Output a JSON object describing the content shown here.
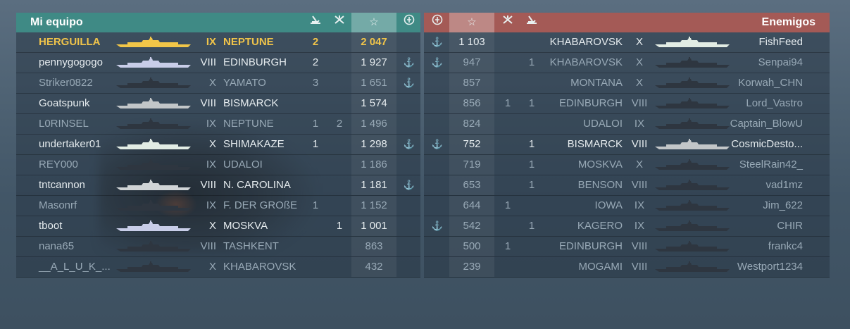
{
  "team": {
    "title": "Mi equipo",
    "header_icons": [
      "torpedo-hits-icon",
      "planes-destroyed-icon",
      "xp-star-icon",
      "achievement-icon"
    ],
    "players": [
      {
        "name": "HERGUILLA",
        "tier": "IX",
        "ship": "NEPTUNE",
        "torp": "2",
        "planes": "",
        "xp": "2 047",
        "ach": "",
        "me": true,
        "dead": false,
        "silhouette": "#f2c648"
      },
      {
        "name": "pennygogogo",
        "tier": "VIII",
        "ship": "EDINBURGH",
        "torp": "2",
        "planes": "",
        "xp": "1 927",
        "ach": "⚓",
        "dead": false,
        "silhouette": "#c8cde8"
      },
      {
        "name": "Striker0822",
        "tier": "X",
        "ship": "YAMATO",
        "torp": "3",
        "planes": "",
        "xp": "1 651",
        "ach": "⚓",
        "dead": true,
        "silhouette": "#2e3640"
      },
      {
        "name": "Goatspunk",
        "tier": "VIII",
        "ship": "BISMARCK",
        "torp": "",
        "planes": "",
        "xp": "1 574",
        "ach": "",
        "dead": false,
        "silhouette": "#c2c6c8"
      },
      {
        "name": "L0RINSEL",
        "tier": "IX",
        "ship": "NEPTUNE",
        "torp": "1",
        "planes": "2",
        "xp": "1 496",
        "ach": "",
        "dead": true,
        "silhouette": "#2e3640"
      },
      {
        "name": "undertaker01",
        "tier": "X",
        "ship": "SHIMAKAZE",
        "torp": "1",
        "planes": "",
        "xp": "1 298",
        "ach": "⚓",
        "dead": false,
        "silhouette": "#e2ece4"
      },
      {
        "name": "REY000",
        "tier": "IX",
        "ship": "UDALOI",
        "torp": "",
        "planes": "",
        "xp": "1 186",
        "ach": "",
        "dead": true,
        "silhouette": "#2e3640"
      },
      {
        "name": "tntcannon",
        "tier": "VIII",
        "ship": "N. CAROLINA",
        "torp": "",
        "planes": "",
        "xp": "1 181",
        "ach": "⚓",
        "dead": false,
        "silhouette": "#d0d4d6"
      },
      {
        "name": "Masonrf",
        "tier": "IX",
        "ship": "F. DER GROßE",
        "torp": "1",
        "planes": "",
        "xp": "1 152",
        "ach": "",
        "dead": true,
        "silhouette": "#2e3640"
      },
      {
        "name": "tboot",
        "tier": "X",
        "ship": "MOSKVA",
        "torp": "",
        "planes": "1",
        "xp": "1 001",
        "ach": "",
        "dead": false,
        "silhouette": "#c8cde8"
      },
      {
        "name": "nana65",
        "tier": "VIII",
        "ship": "TASHKENT",
        "torp": "",
        "planes": "",
        "xp": "863",
        "ach": "",
        "dead": true,
        "silhouette": "#2e3640"
      },
      {
        "name": "__A_L_U_K_...",
        "tier": "X",
        "ship": "KHABAROVSK",
        "torp": "",
        "planes": "",
        "xp": "432",
        "ach": "",
        "dead": true,
        "silhouette": "#2e3640"
      }
    ]
  },
  "enemy": {
    "title": "Enemigos",
    "header_icons": [
      "achievement-icon",
      "xp-star-icon",
      "planes-destroyed-icon",
      "torpedo-hits-icon"
    ],
    "players": [
      {
        "ach": "⚓",
        "xp": "1 103",
        "planes": "",
        "torp": "",
        "ship": "KHABAROVSK",
        "tier": "X",
        "name": "FishFeed",
        "dead": false,
        "silhouette": "#e2ece4"
      },
      {
        "ach": "⚓",
        "xp": "947",
        "planes": "",
        "torp": "1",
        "ship": "KHABAROVSK",
        "tier": "X",
        "name": "Senpai94",
        "dead": true,
        "silhouette": "#2e3640"
      },
      {
        "ach": "",
        "xp": "857",
        "planes": "",
        "torp": "",
        "ship": "MONTANA",
        "tier": "X",
        "name": "Korwah_CHN",
        "dead": true,
        "silhouette": "#2e3640"
      },
      {
        "ach": "",
        "xp": "856",
        "planes": "1",
        "torp": "1",
        "ship": "EDINBURGH",
        "tier": "VIII",
        "name": "Lord_Vastro",
        "dead": true,
        "silhouette": "#2e3640"
      },
      {
        "ach": "",
        "xp": "824",
        "planes": "",
        "torp": "",
        "ship": "UDALOI",
        "tier": "IX",
        "name": "Captain_BlowU",
        "dead": true,
        "silhouette": "#2e3640"
      },
      {
        "ach": "⚓",
        "xp": "752",
        "planes": "",
        "torp": "1",
        "ship": "BISMARCK",
        "tier": "VIII",
        "name": "CosmicDesto...",
        "dead": false,
        "silhouette": "#c2c6c8"
      },
      {
        "ach": "",
        "xp": "719",
        "planes": "",
        "torp": "1",
        "ship": "MOSKVA",
        "tier": "X",
        "name": "SteelRain42_",
        "dead": true,
        "silhouette": "#2e3640"
      },
      {
        "ach": "",
        "xp": "653",
        "planes": "",
        "torp": "1",
        "ship": "BENSON",
        "tier": "VIII",
        "name": "vad1mz",
        "dead": true,
        "silhouette": "#2e3640"
      },
      {
        "ach": "",
        "xp": "644",
        "planes": "1",
        "torp": "",
        "ship": "IOWA",
        "tier": "IX",
        "name": "Jim_622",
        "dead": true,
        "silhouette": "#2e3640"
      },
      {
        "ach": "⚓",
        "xp": "542",
        "planes": "",
        "torp": "1",
        "ship": "KAGERO",
        "tier": "IX",
        "name": "CHIR",
        "dead": true,
        "silhouette": "#2e3640"
      },
      {
        "ach": "",
        "xp": "500",
        "planes": "1",
        "torp": "",
        "ship": "EDINBURGH",
        "tier": "VIII",
        "name": "frankc4",
        "dead": true,
        "silhouette": "#2e3640"
      },
      {
        "ach": "",
        "xp": "239",
        "planes": "",
        "torp": "",
        "ship": "MOGAMI",
        "tier": "VIII",
        "name": "Westport1234",
        "dead": true,
        "silhouette": "#2e3640"
      }
    ]
  }
}
